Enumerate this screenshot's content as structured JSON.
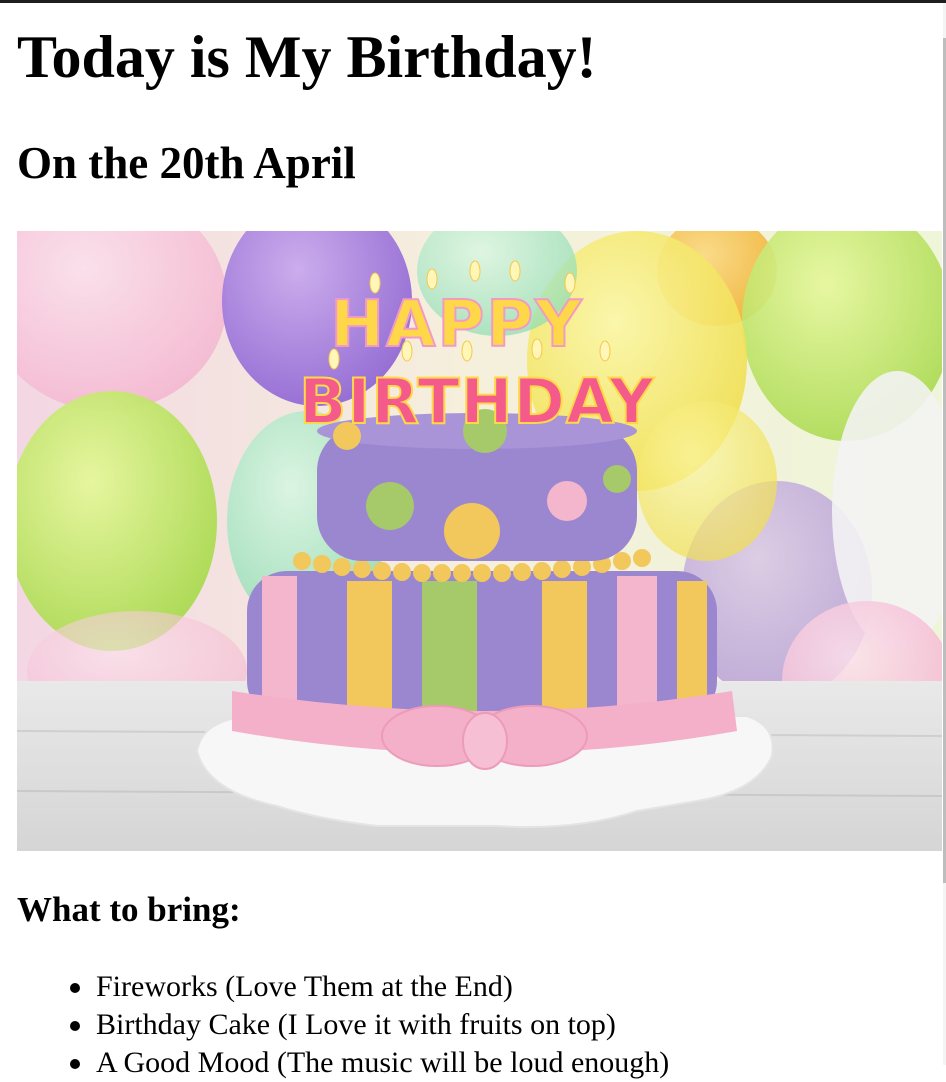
{
  "page": {
    "heading": "Today is My Birthday!",
    "date_heading": "On the 20th April",
    "image": {
      "kind": "birthday-cake-photo",
      "cake_topper_line1": "HAPPY",
      "cake_topper_line2": "BIRTHDAY"
    },
    "bring_heading": "What to bring:",
    "bring_items": [
      {
        "text": "Fireworks (Love Them at the End)"
      },
      {
        "text": "Birthday Cake (I Love it with fruits on top)"
      },
      {
        "text": "A Good Mood (The music will be loud enough)"
      }
    ]
  },
  "colors": {
    "text": "#000000",
    "background": "#ffffff",
    "cake_purple": "#9b86d0",
    "cake_yellow": "#f2c75c",
    "cake_green": "#a6c96a",
    "cake_pink": "#f3b6cd"
  }
}
